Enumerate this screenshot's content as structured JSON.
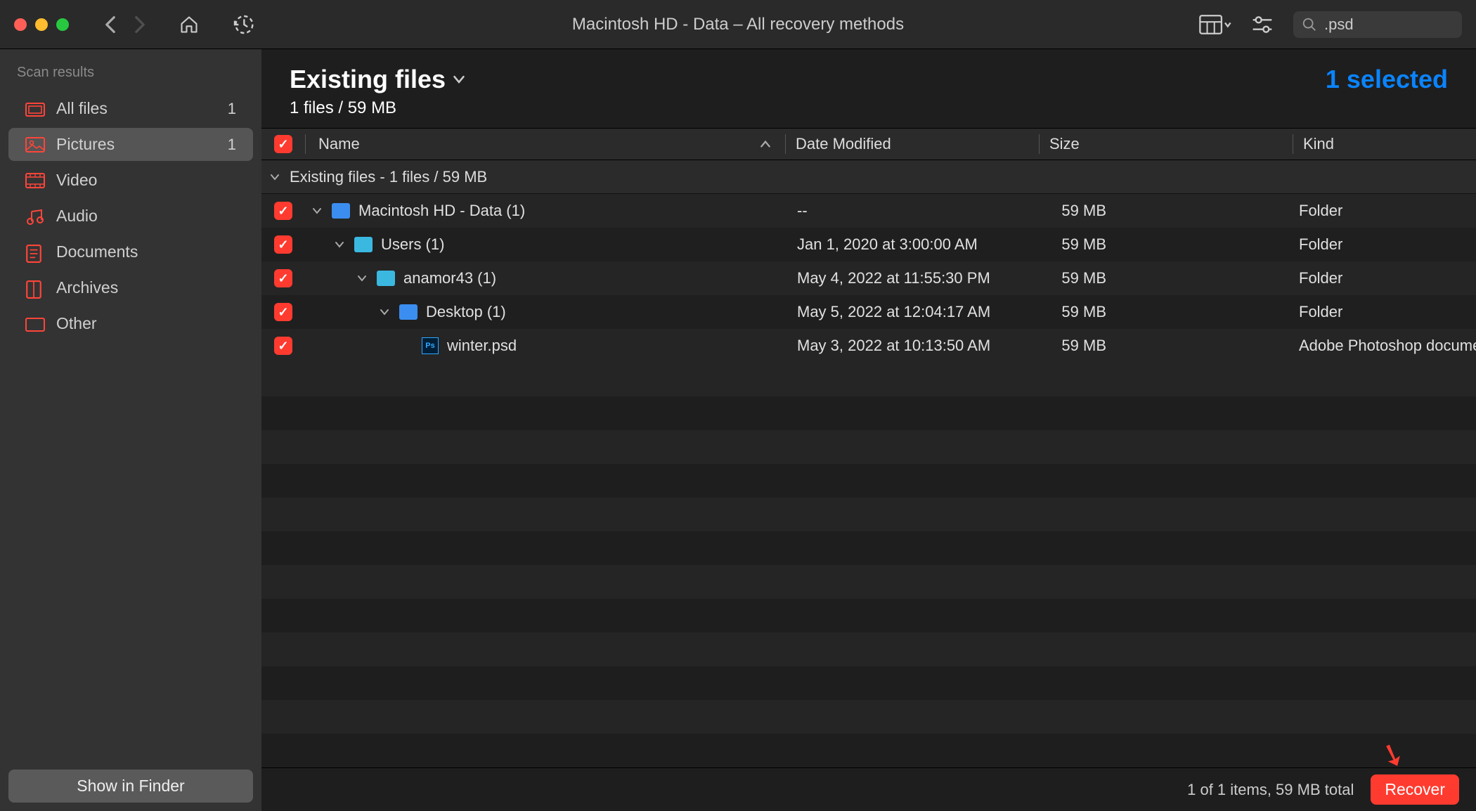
{
  "window": {
    "title": "Macintosh HD - Data – All recovery methods"
  },
  "search": {
    "value": ".psd"
  },
  "sidebar": {
    "header": "Scan results",
    "items": [
      {
        "label": "All files",
        "count": "1"
      },
      {
        "label": "Pictures",
        "count": "1"
      },
      {
        "label": "Video",
        "count": ""
      },
      {
        "label": "Audio",
        "count": ""
      },
      {
        "label": "Documents",
        "count": ""
      },
      {
        "label": "Archives",
        "count": ""
      },
      {
        "label": "Other",
        "count": ""
      }
    ],
    "footer_button": "Show in Finder"
  },
  "content": {
    "heading": "Existing files",
    "sub_heading": "1 files / 59 MB",
    "selected_text": "1 selected",
    "columns": {
      "name": "Name",
      "date": "Date Modified",
      "size": "Size",
      "kind": "Kind"
    },
    "group_label": "Existing files - 1 files / 59 MB",
    "rows": [
      {
        "indent": 0,
        "chev": true,
        "name": "Macintosh HD - Data (1)",
        "date": "--",
        "size": "59 MB",
        "kind": "Folder",
        "icon": "folder-blue",
        "check": true
      },
      {
        "indent": 1,
        "chev": true,
        "name": "Users (1)",
        "date": "Jan 1, 2020 at 3:00:00 AM",
        "size": "59 MB",
        "kind": "Folder",
        "icon": "folder-cyan",
        "check": true
      },
      {
        "indent": 2,
        "chev": true,
        "name": "anamor43 (1)",
        "date": "May 4, 2022 at 11:55:30 PM",
        "size": "59 MB",
        "kind": "Folder",
        "icon": "folder-cyan",
        "check": true
      },
      {
        "indent": 3,
        "chev": true,
        "name": "Desktop (1)",
        "date": "May 5, 2022 at 12:04:17 AM",
        "size": "59 MB",
        "kind": "Folder",
        "icon": "folder-blue",
        "check": true
      },
      {
        "indent": 4,
        "chev": false,
        "name": "winter.psd",
        "date": "May 3, 2022 at 10:13:50 AM",
        "size": "59 MB",
        "kind": "Adobe Photoshop document",
        "icon": "ps",
        "check": true
      }
    ]
  },
  "footer": {
    "status": "1 of 1 items, 59 MB total",
    "recover": "Recover"
  },
  "icons": {
    "colors": {
      "all_files": "#ff453a",
      "pictures": "#ff453a",
      "video": "#ff453a",
      "audio": "#ff453a",
      "documents": "#ff453a",
      "archives": "#ff453a",
      "other": "#ff453a"
    }
  }
}
